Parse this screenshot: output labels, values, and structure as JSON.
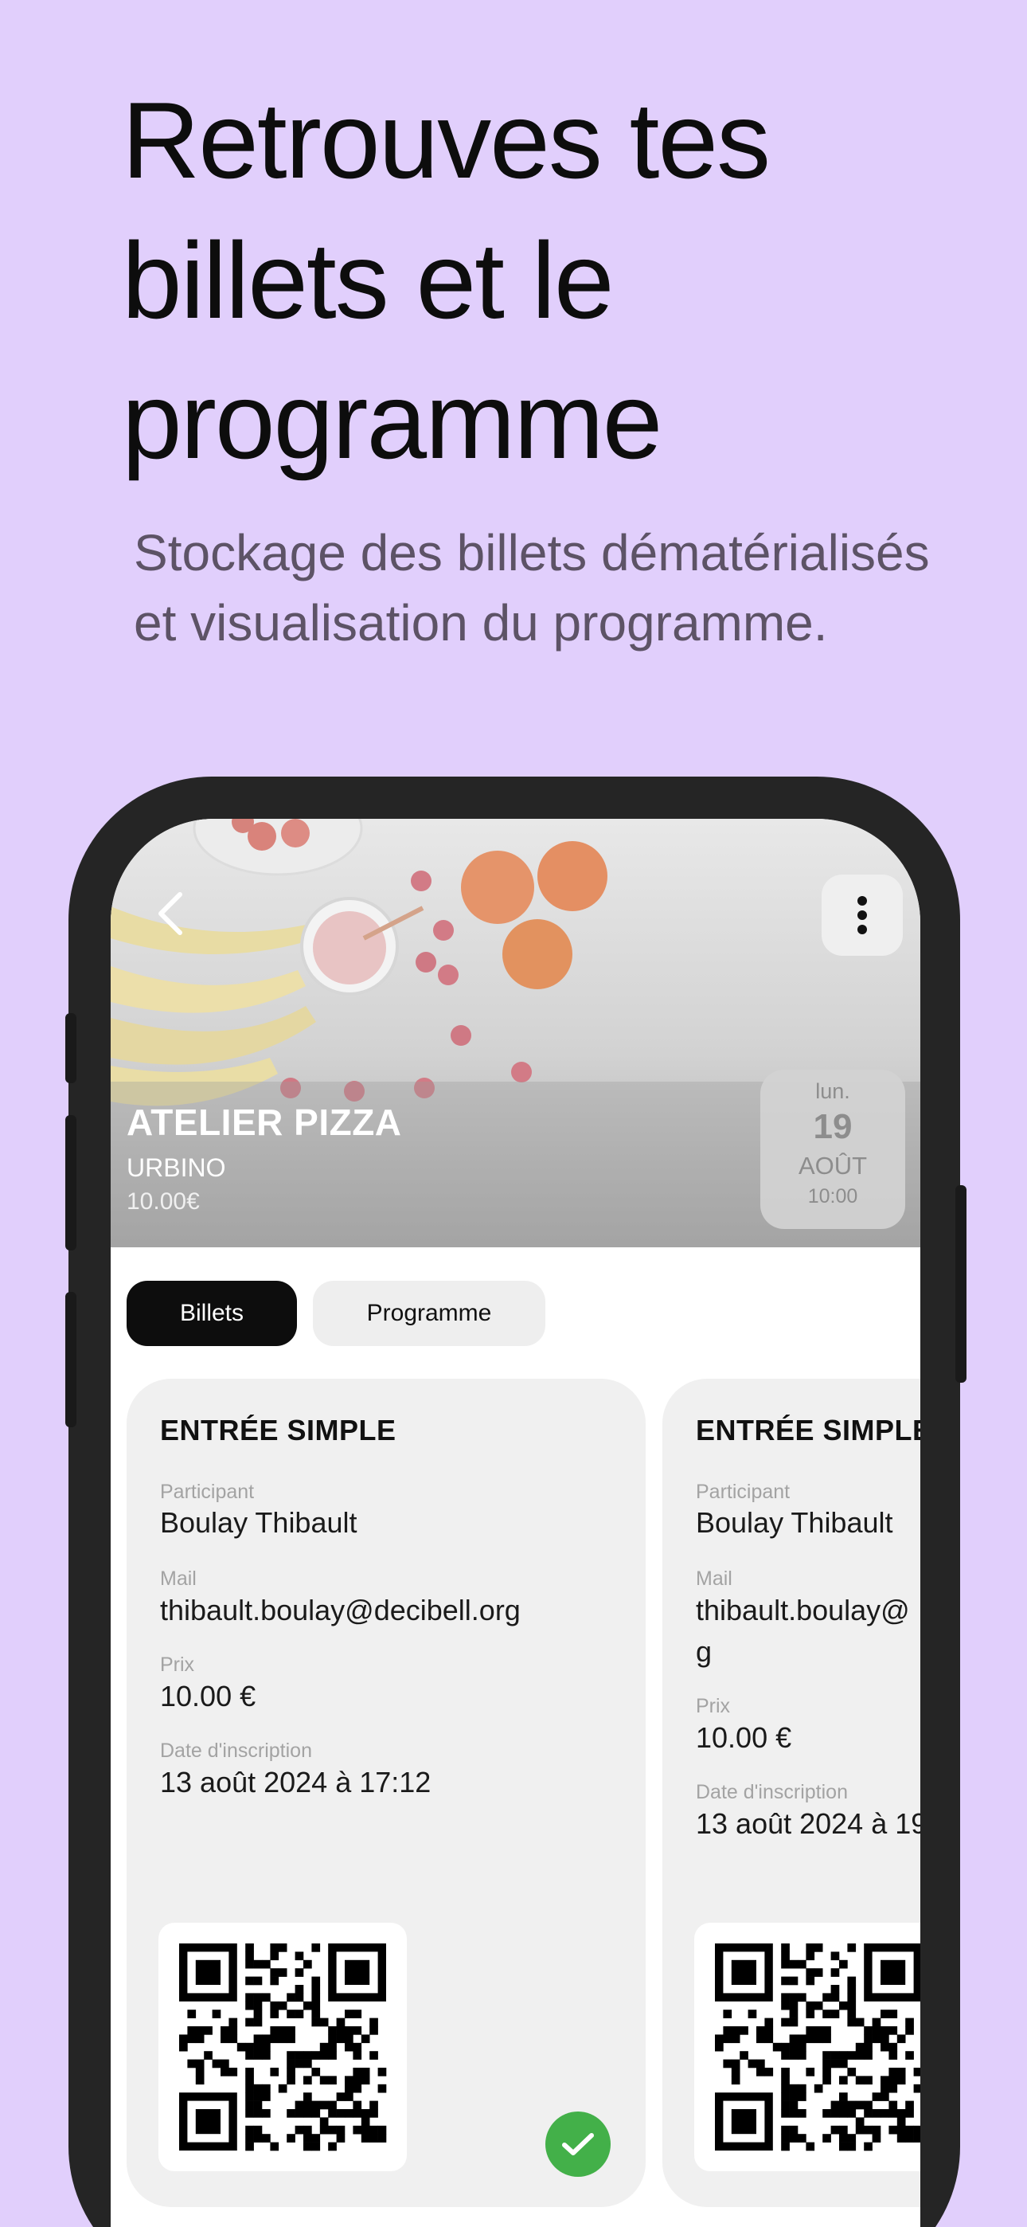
{
  "promo": {
    "headline": "Retrouves tes billets et le programme",
    "subline": "Stockage des billets dématérialisés  et visualisation du programme."
  },
  "header": {
    "back_icon": "chevron-left-icon",
    "menu_icon": "more-vertical-icon"
  },
  "event": {
    "title": "ATELIER PIZZA",
    "city": "URBINO",
    "price": "10.00€",
    "date": {
      "weekday": "lun.",
      "day": "19",
      "month": "AOÛT",
      "time": "10:00"
    }
  },
  "tabs": [
    {
      "label": "Billets",
      "active": true
    },
    {
      "label": "Programme",
      "active": false
    }
  ],
  "tickets": [
    {
      "title": "ENTRÉE SIMPLE",
      "participant_label": "Participant",
      "participant": "Boulay Thibault",
      "mail_label": "Mail",
      "mail": "thibault.boulay@decibell.org",
      "price_label": "Prix",
      "price": "10.00 €",
      "date_label": "Date d'inscription",
      "date": "13 août 2024 à 17:12",
      "validated": true
    },
    {
      "title": "ENTRÉE SIMPLE",
      "participant_label": "Participant",
      "participant": "Boulay Thibault",
      "mail_label": "Mail",
      "mail": "thibault.boulay@",
      "mail_wrap": "g",
      "price_label": "Prix",
      "price": "10.00 €",
      "date_label": "Date d'inscription",
      "date": "13 août 2024 à 19"
    }
  ],
  "colors": {
    "background": "#e1cffc",
    "phone_frame": "#252525",
    "tab_active": "#0d0d0d",
    "card": "#f0f0f0",
    "validated": "#43b049"
  }
}
